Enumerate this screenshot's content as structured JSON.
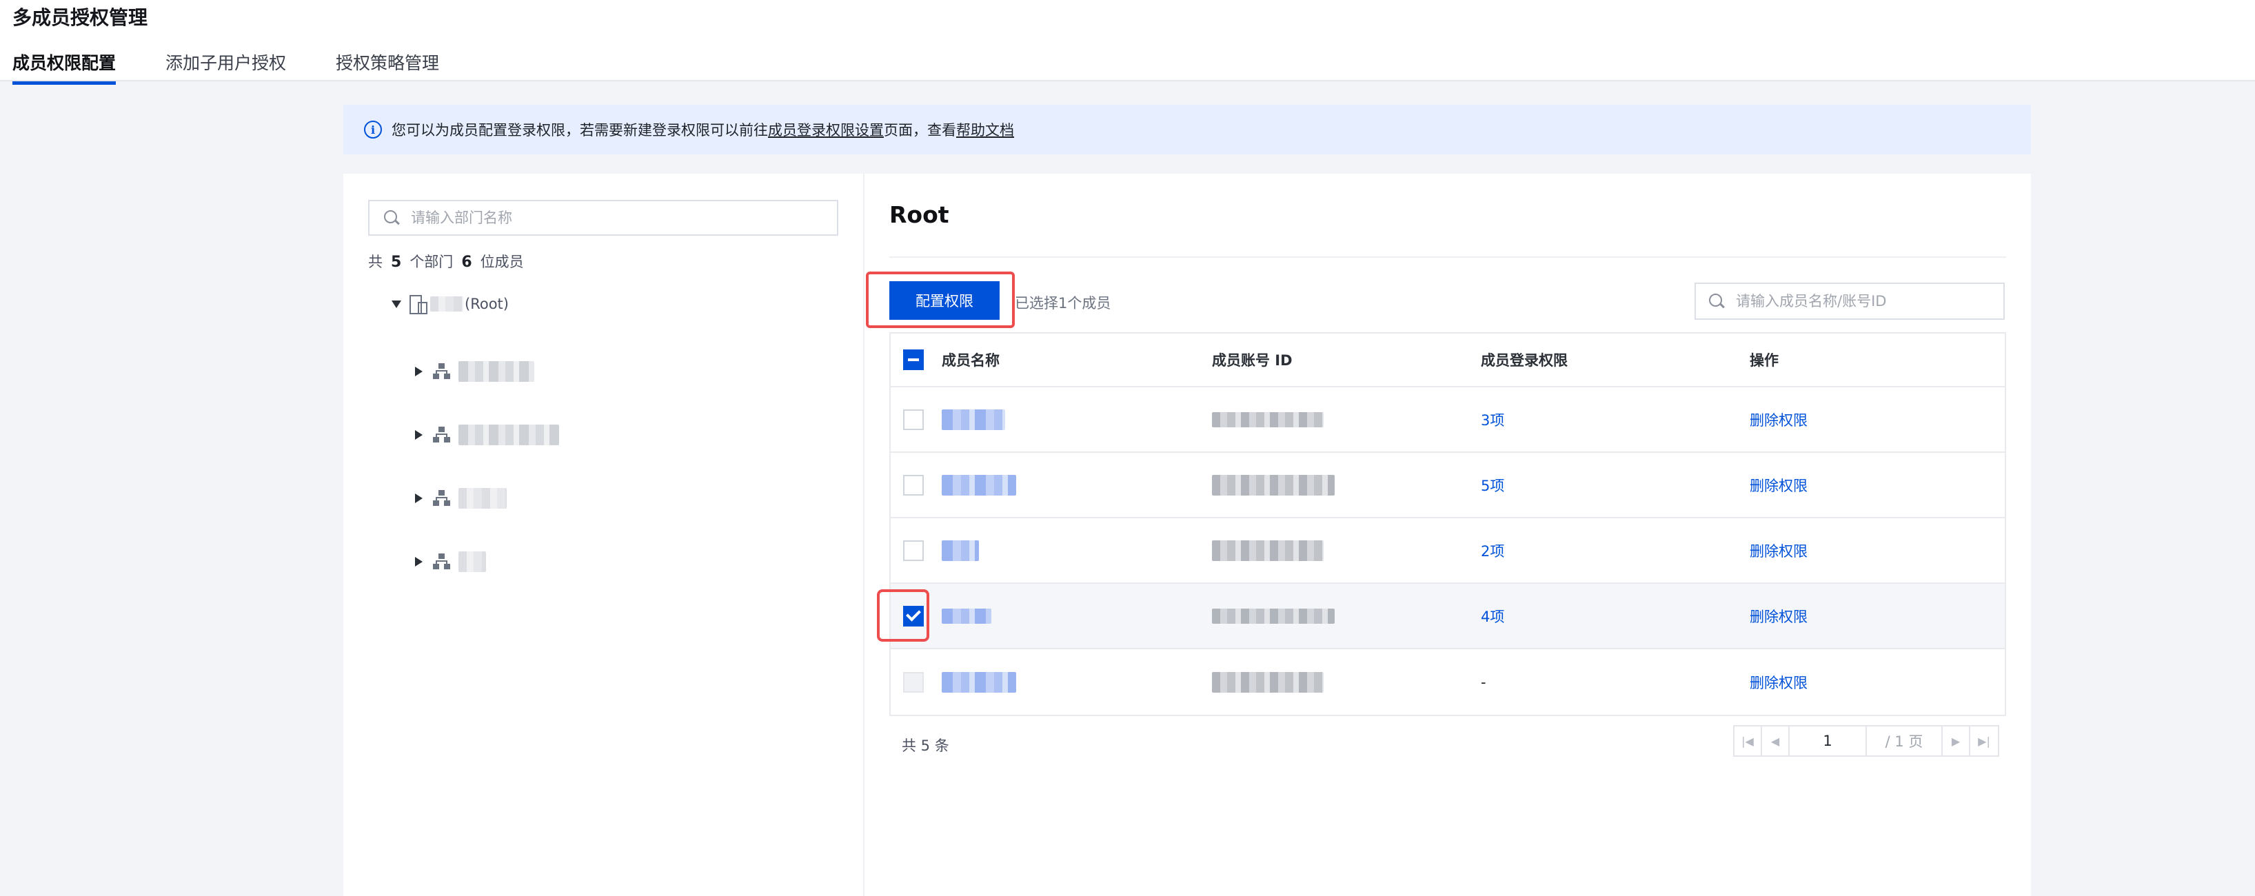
{
  "app": {
    "title": "多成员授权管理"
  },
  "tabs": [
    {
      "label": "成员权限配置",
      "active": true
    },
    {
      "label": "添加子用户授权",
      "active": false
    },
    {
      "label": "授权策略管理",
      "active": false
    }
  ],
  "notice": {
    "icon": "info-icon",
    "text_before": "您可以为成员配置登录权限，若需要新建登录权限可以前往",
    "link1": "成员登录权限设置",
    "text_mid": "页面，查看",
    "link2": "帮助文档"
  },
  "left": {
    "search_placeholder": "请输入部门名称",
    "summary_prefix": "共",
    "dept_count": "5",
    "dept_label": "个部门",
    "member_count": "6",
    "member_label": "位成员",
    "root_label": "(Root)"
  },
  "right": {
    "title": "Root",
    "config_button": "配置权限",
    "selected_text": "已选择1个成员",
    "search_placeholder": "请输入成员名称/账号ID",
    "columns": {
      "name": "成员名称",
      "account": "成员账号 ID",
      "permission": "成员登录权限",
      "action": "操作"
    },
    "rows": [
      {
        "permission": "3项",
        "action": "删除权限",
        "checked": false
      },
      {
        "permission": "5项",
        "action": "删除权限",
        "checked": false
      },
      {
        "permission": "2项",
        "action": "删除权限",
        "checked": false
      },
      {
        "permission": "4项",
        "action": "删除权限",
        "checked": true
      },
      {
        "permission": "-",
        "action": "删除权限",
        "checked": false
      }
    ],
    "total_text": "共 5 条",
    "pager": {
      "current": "1",
      "total": "/ 1 页"
    }
  },
  "colors": {
    "accent": "#0052d9",
    "highlight": "#ee4d4d"
  }
}
